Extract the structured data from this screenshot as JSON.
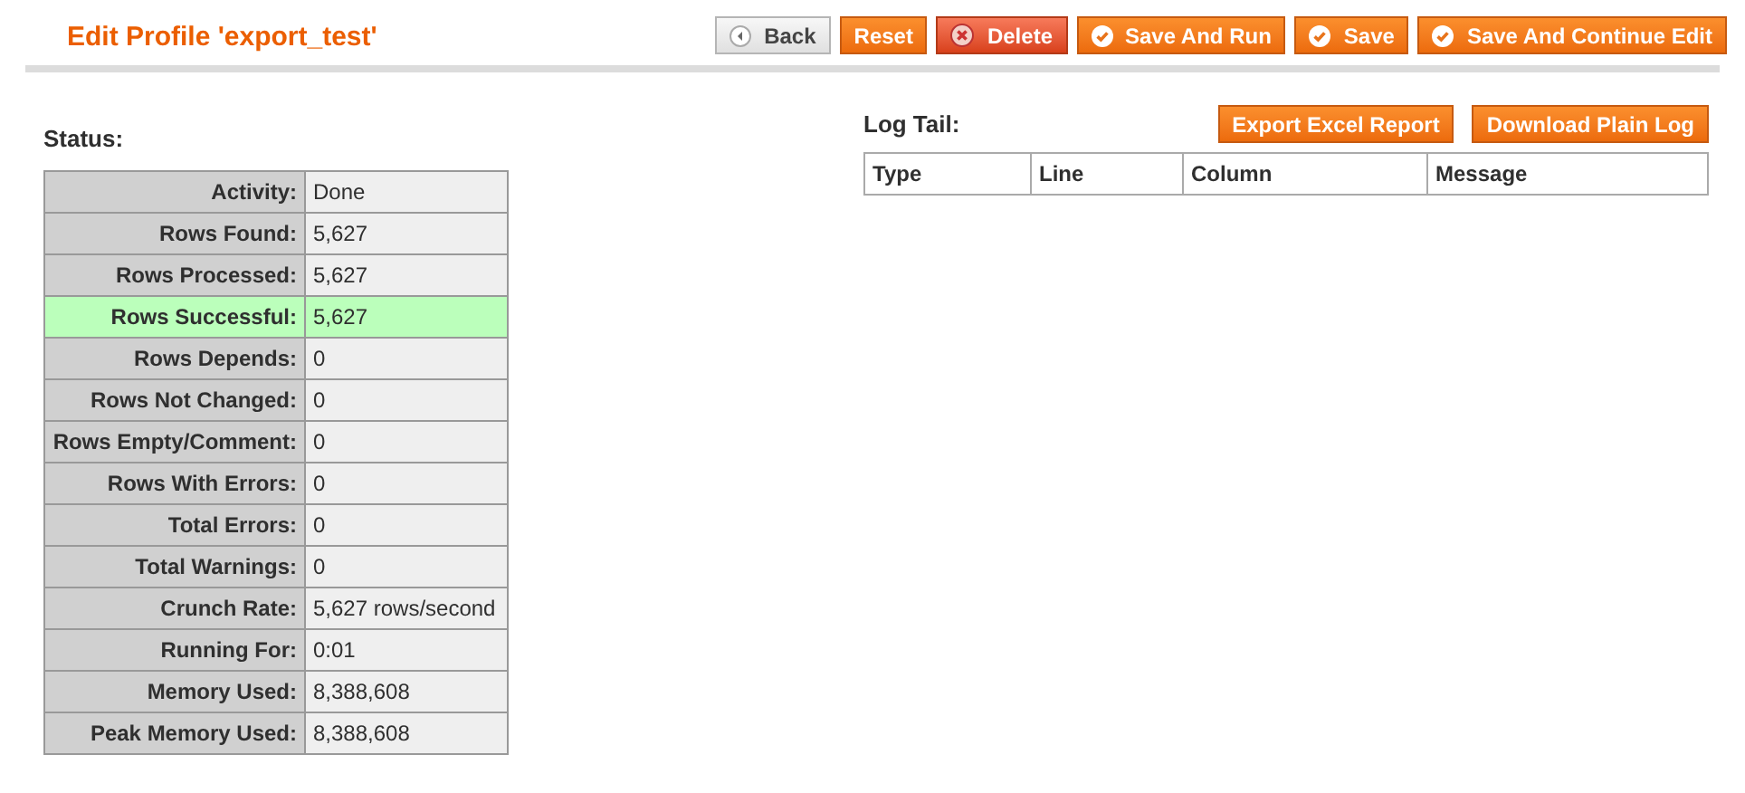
{
  "title": "Edit Profile 'export_test'",
  "buttons": [
    {
      "label": "Back",
      "kind": "back"
    },
    {
      "label": "Reset",
      "kind": "plain"
    },
    {
      "label": "Delete",
      "kind": "delete"
    },
    {
      "label": "Save And Run",
      "kind": "save"
    },
    {
      "label": "Save",
      "kind": "save"
    },
    {
      "label": "Save And Continue Edit",
      "kind": "save"
    }
  ],
  "status": {
    "heading": "Status:",
    "rows": [
      {
        "label": "Activity:",
        "value": "Done",
        "highlighted": false
      },
      {
        "label": "Rows Found:",
        "value": "5,627",
        "highlighted": false
      },
      {
        "label": "Rows Processed:",
        "value": "5,627",
        "highlighted": false
      },
      {
        "label": "Rows Successful:",
        "value": "5,627",
        "highlighted": true
      },
      {
        "label": "Rows Depends:",
        "value": "0",
        "highlighted": false
      },
      {
        "label": "Rows Not Changed:",
        "value": "0",
        "highlighted": false
      },
      {
        "label": "Rows Empty/Comment:",
        "value": "0",
        "highlighted": false
      },
      {
        "label": "Rows With Errors:",
        "value": "0",
        "highlighted": false
      },
      {
        "label": "Total Errors:",
        "value": "0",
        "highlighted": false
      },
      {
        "label": "Total Warnings:",
        "value": "0",
        "highlighted": false
      },
      {
        "label": "Crunch Rate:",
        "value": "5,627 rows/second",
        "highlighted": false
      },
      {
        "label": "Running For:",
        "value": "0:01",
        "highlighted": false
      },
      {
        "label": "Memory Used:",
        "value": "8,388,608",
        "highlighted": false
      },
      {
        "label": "Peak Memory Used:",
        "value": "8,388,608",
        "highlighted": false
      }
    ]
  },
  "log_tail": {
    "heading": "Log Tail:",
    "buttons": [
      "Export Excel Report",
      "Download Plain Log"
    ],
    "columns": [
      "Type",
      "Line",
      "Column",
      "Message"
    ]
  }
}
